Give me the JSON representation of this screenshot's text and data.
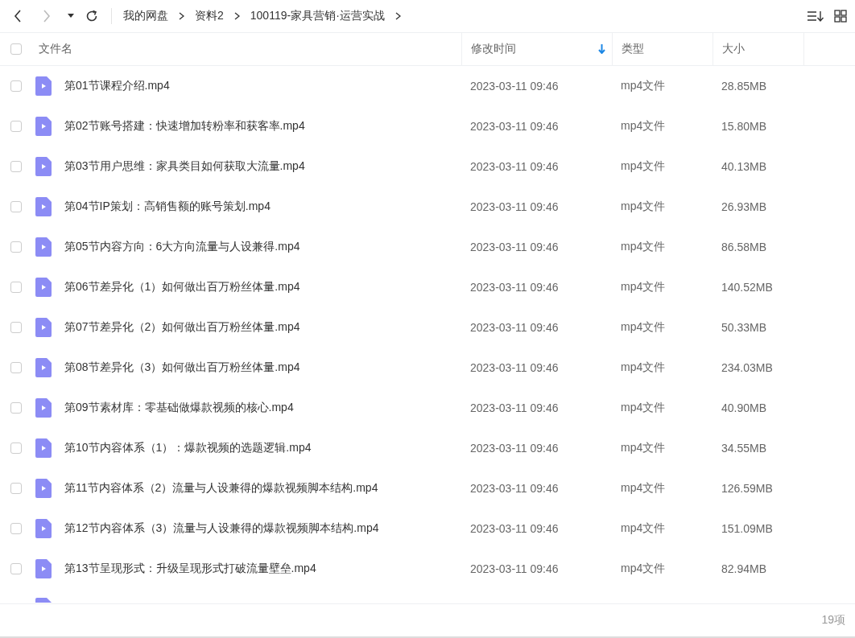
{
  "nav": {
    "back": {
      "disabled": false
    },
    "forward": {
      "disabled": true
    }
  },
  "breadcrumb": [
    "我的网盘",
    "资料2",
    "100119-家具营销·运营实战"
  ],
  "table": {
    "select_all": {
      "checked": false
    },
    "columns": [
      {
        "label": "文件名",
        "sorted": false
      },
      {
        "label": "修改时间",
        "sorted": true
      },
      {
        "label": "类型",
        "sorted": false
      },
      {
        "label": "大小",
        "sorted": false
      }
    ],
    "rows": [
      {
        "checked": false,
        "name": "第01节课程介绍.mp4",
        "modified": "2023-03-11 09:46",
        "type": "mp4文件",
        "size": "28.85MB"
      },
      {
        "checked": false,
        "name": "第02节账号搭建：快速增加转粉率和获客率.mp4",
        "modified": "2023-03-11 09:46",
        "type": "mp4文件",
        "size": "15.80MB"
      },
      {
        "checked": false,
        "name": "第03节用户思维：家具类目如何获取大流量.mp4",
        "modified": "2023-03-11 09:46",
        "type": "mp4文件",
        "size": "40.13MB"
      },
      {
        "checked": false,
        "name": "第04节IP策划：高销售额的账号策划.mp4",
        "modified": "2023-03-11 09:46",
        "type": "mp4文件",
        "size": "26.93MB"
      },
      {
        "checked": false,
        "name": "第05节内容方向：6大方向流量与人设兼得.mp4",
        "modified": "2023-03-11 09:46",
        "type": "mp4文件",
        "size": "86.58MB"
      },
      {
        "checked": false,
        "name": "第06节差异化（1）如何做出百万粉丝体量.mp4",
        "modified": "2023-03-11 09:46",
        "type": "mp4文件",
        "size": "140.52MB"
      },
      {
        "checked": false,
        "name": "第07节差异化（2）如何做出百万粉丝体量.mp4",
        "modified": "2023-03-11 09:46",
        "type": "mp4文件",
        "size": "50.33MB"
      },
      {
        "checked": false,
        "name": "第08节差异化（3）如何做出百万粉丝体量.mp4",
        "modified": "2023-03-11 09:46",
        "type": "mp4文件",
        "size": "234.03MB"
      },
      {
        "checked": false,
        "name": "第09节素材库：零基础做爆款视频的核心.mp4",
        "modified": "2023-03-11 09:46",
        "type": "mp4文件",
        "size": "40.90MB"
      },
      {
        "checked": false,
        "name": "第10节内容体系（1）：爆款视频的选题逻辑.mp4",
        "modified": "2023-03-11 09:46",
        "type": "mp4文件",
        "size": "34.55MB"
      },
      {
        "checked": false,
        "name": "第11节内容体系（2）流量与人设兼得的爆款视频脚本结构.mp4",
        "modified": "2023-03-11 09:46",
        "type": "mp4文件",
        "size": "126.59MB"
      },
      {
        "checked": false,
        "name": "第12节内容体系（3）流量与人设兼得的爆款视频脚本结构.mp4",
        "modified": "2023-03-11 09:46",
        "type": "mp4文件",
        "size": "151.09MB"
      },
      {
        "checked": false,
        "name": "第13节呈现形式：升级呈现形式打破流量壁垒.mp4",
        "modified": "2023-03-11 09:46",
        "type": "mp4文件",
        "size": "82.94MB"
      }
    ]
  },
  "status_bar": {
    "count": "19项"
  }
}
